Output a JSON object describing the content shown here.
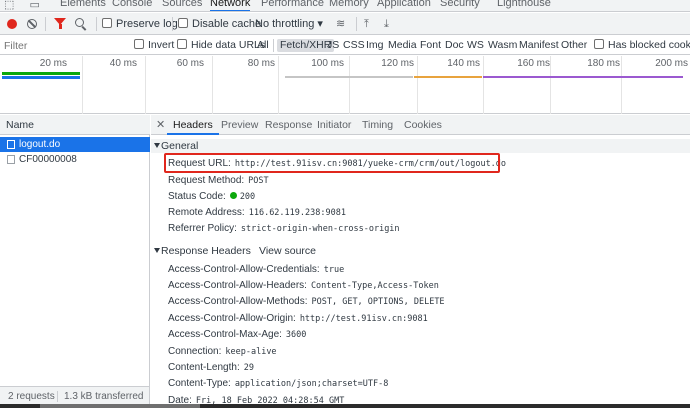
{
  "devtools_tabs": [
    "Elements",
    "Console",
    "Sources",
    "Network",
    "Performance",
    "Memory",
    "Application",
    "Security",
    "Lighthouse"
  ],
  "active_devtools_tab": "Network",
  "toolbar": {
    "preserve_log": "Preserve log",
    "disable_cache": "Disable cache",
    "throttling": "No throttling"
  },
  "filter": {
    "placeholder": "Filter",
    "invert": "Invert",
    "hide_data_urls": "Hide data URLs",
    "types": [
      "All",
      "Fetch/XHR",
      "JS",
      "CSS",
      "Img",
      "Media",
      "Font",
      "Doc",
      "WS",
      "Wasm",
      "Manifest",
      "Other"
    ],
    "active_type": "Fetch/XHR",
    "blocked_cookies": "Has blocked cookies"
  },
  "timeline": {
    "ticks": [
      "20 ms",
      "40 ms",
      "60 ms",
      "80 ms",
      "100 ms",
      "120 ms",
      "140 ms",
      "160 ms",
      "180 ms",
      "200 ms"
    ],
    "colors": {
      "green": "#0ca80c",
      "blue": "#1a73e8",
      "orange": "#e8a33d",
      "purple": "#9b59d0"
    }
  },
  "requests": {
    "column_name": "Name",
    "items": [
      {
        "name": "logout.do",
        "selected": true
      },
      {
        "name": "CF00000008",
        "selected": false
      }
    ],
    "status_requests": "2 requests",
    "status_transferred": "1.3 kB transferred"
  },
  "detail_tabs": [
    "Headers",
    "Preview",
    "Response",
    "Initiator",
    "Timing",
    "Cookies"
  ],
  "active_detail_tab": "Headers",
  "general": {
    "title": "General",
    "request_url_label": "Request URL:",
    "request_url": "http://test.91isv.cn:9081/yueke-crm/crm/out/logout.do",
    "request_method_label": "Request Method:",
    "request_method": "POST",
    "status_code_label": "Status Code:",
    "status_code": "200",
    "remote_address_label": "Remote Address:",
    "remote_address": "116.62.119.238:9081",
    "referrer_policy_label": "Referrer Policy:",
    "referrer_policy": "strict-origin-when-cross-origin"
  },
  "response_headers": {
    "title": "Response Headers",
    "view_source": "View source",
    "items": [
      {
        "k": "Access-Control-Allow-Credentials:",
        "v": "true"
      },
      {
        "k": "Access-Control-Allow-Headers:",
        "v": "Content-Type,Access-Token"
      },
      {
        "k": "Access-Control-Allow-Methods:",
        "v": "POST, GET, OPTIONS, DELETE"
      },
      {
        "k": "Access-Control-Allow-Origin:",
        "v": "http://test.91isv.cn:9081"
      },
      {
        "k": "Access-Control-Max-Age:",
        "v": "3600"
      },
      {
        "k": "Connection:",
        "v": "keep-alive"
      },
      {
        "k": "Content-Length:",
        "v": "29"
      },
      {
        "k": "Content-Type:",
        "v": "application/json;charset=UTF-8"
      },
      {
        "k": "Date:",
        "v": "Fri, 18 Feb 2022 04:28:54 GMT"
      }
    ]
  },
  "accent_color": "#1a73e8",
  "highlight_color": "#e0271d"
}
